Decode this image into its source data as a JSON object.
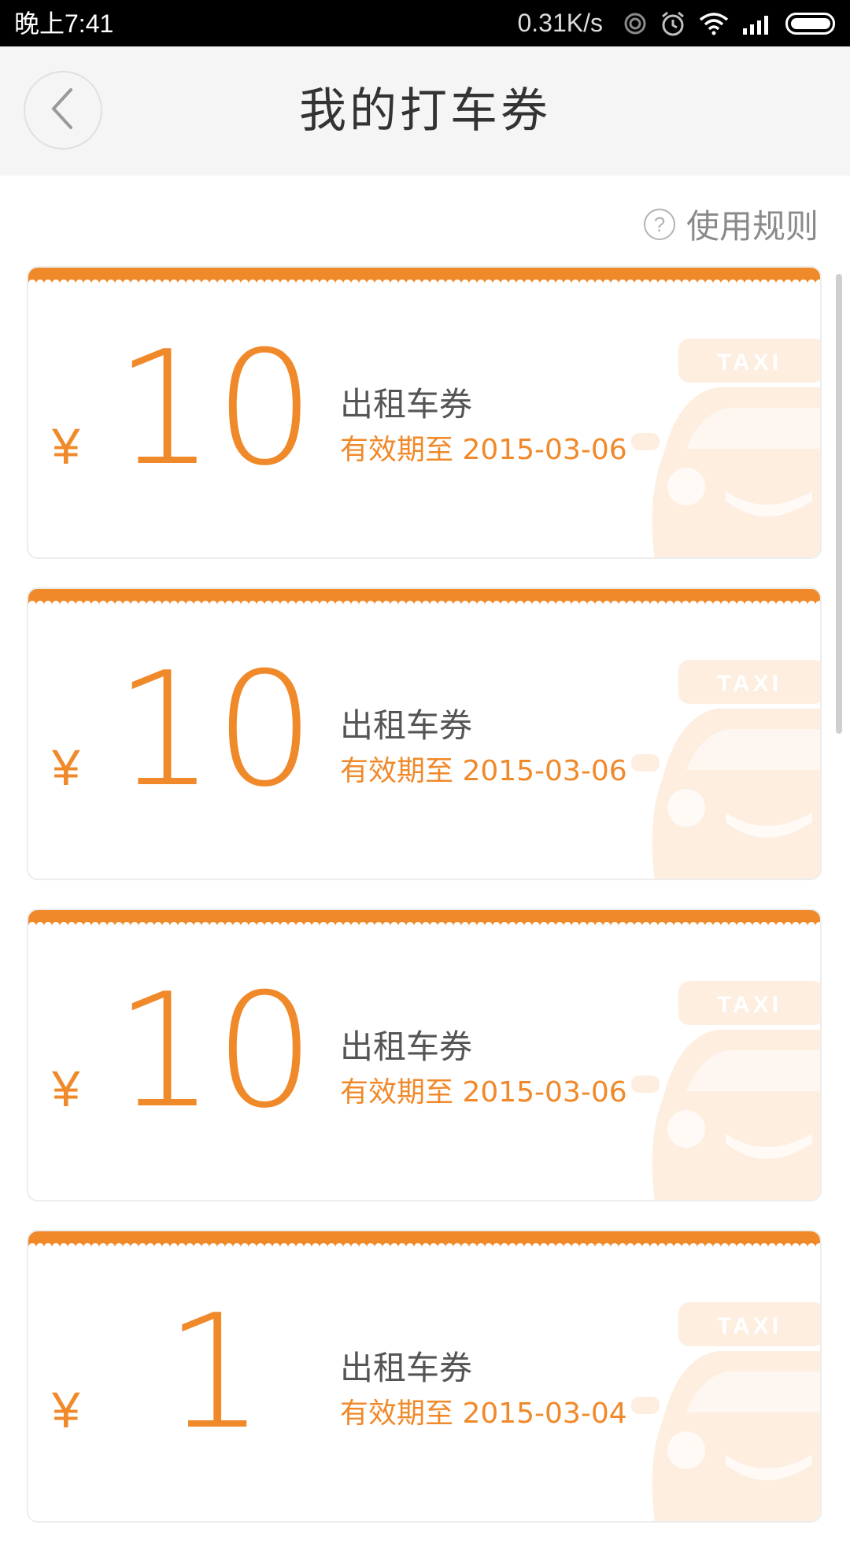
{
  "status_bar": {
    "time": "晚上7:41",
    "net_speed": "0.31K/s",
    "icons": [
      "hotspot-icon",
      "alarm-icon",
      "wifi-icon",
      "signal-icon",
      "battery-icon"
    ]
  },
  "header": {
    "title": "我的打车券",
    "back_icon": "chevron-left-icon"
  },
  "rules": {
    "icon_glyph": "?",
    "label": "使用规则"
  },
  "colors": {
    "accent": "#f0892a",
    "header_bg": "#f5f5f5",
    "title_text": "#333333",
    "watermark": "#fdeee0"
  },
  "coupons": [
    {
      "currency": "¥",
      "amount": "10",
      "name": "出租车券",
      "expiry": "有效期至 2015-03-06",
      "watermark_text": "TAXI"
    },
    {
      "currency": "¥",
      "amount": "10",
      "name": "出租车券",
      "expiry": "有效期至 2015-03-06",
      "watermark_text": "TAXI"
    },
    {
      "currency": "¥",
      "amount": "10",
      "name": "出租车券",
      "expiry": "有效期至 2015-03-06",
      "watermark_text": "TAXI"
    },
    {
      "currency": "¥",
      "amount": "1",
      "name": "出租车券",
      "expiry": "有效期至 2015-03-04",
      "watermark_text": "TAXI"
    }
  ]
}
